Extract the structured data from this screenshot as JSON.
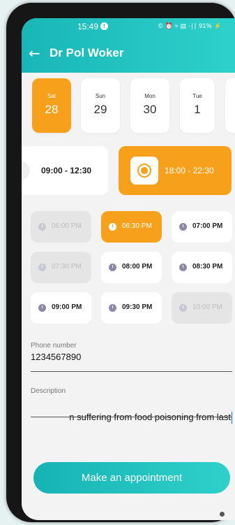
{
  "status_bar": {
    "time": "15:49",
    "badge": "!",
    "icons_text": "© ⏰ ≈ ▤ ·∣∣ 91% ⚡"
  },
  "header": {
    "back_icon": "arrow-left-icon",
    "title": "Dr Pol Woker"
  },
  "days": [
    {
      "name": "Sat",
      "date": "28",
      "selected": true
    },
    {
      "name": "Sun",
      "date": "29",
      "selected": false
    },
    {
      "name": "Mon",
      "date": "30",
      "selected": false
    },
    {
      "name": "Tue",
      "date": "1",
      "selected": false
    }
  ],
  "time_ranges": [
    {
      "label": "09:00 - 12:30",
      "selected": false
    },
    {
      "label": "18:00 - 22:30",
      "selected": true
    }
  ],
  "slots": [
    {
      "label": "06:00 PM",
      "state": "disabled"
    },
    {
      "label": "06:30 PM",
      "state": "selected"
    },
    {
      "label": "07:00 PM",
      "state": "available"
    },
    {
      "label": "07:30 PM",
      "state": "disabled"
    },
    {
      "label": "08:00 PM",
      "state": "available"
    },
    {
      "label": "08:30 PM",
      "state": "available"
    },
    {
      "label": "09:00 PM",
      "state": "available"
    },
    {
      "label": "09:30 PM",
      "state": "available"
    },
    {
      "label": "10:00 PM",
      "state": "disabled"
    }
  ],
  "form": {
    "phone_label": "Phone number",
    "phone_value": "1234567890",
    "description_label": "Description",
    "description_value": "n suffering from food poisoning from last"
  },
  "cta": {
    "label": "Make an appointment"
  },
  "colors": {
    "accent_teal": "#19b6b8",
    "accent_orange": "#f7a01c"
  }
}
